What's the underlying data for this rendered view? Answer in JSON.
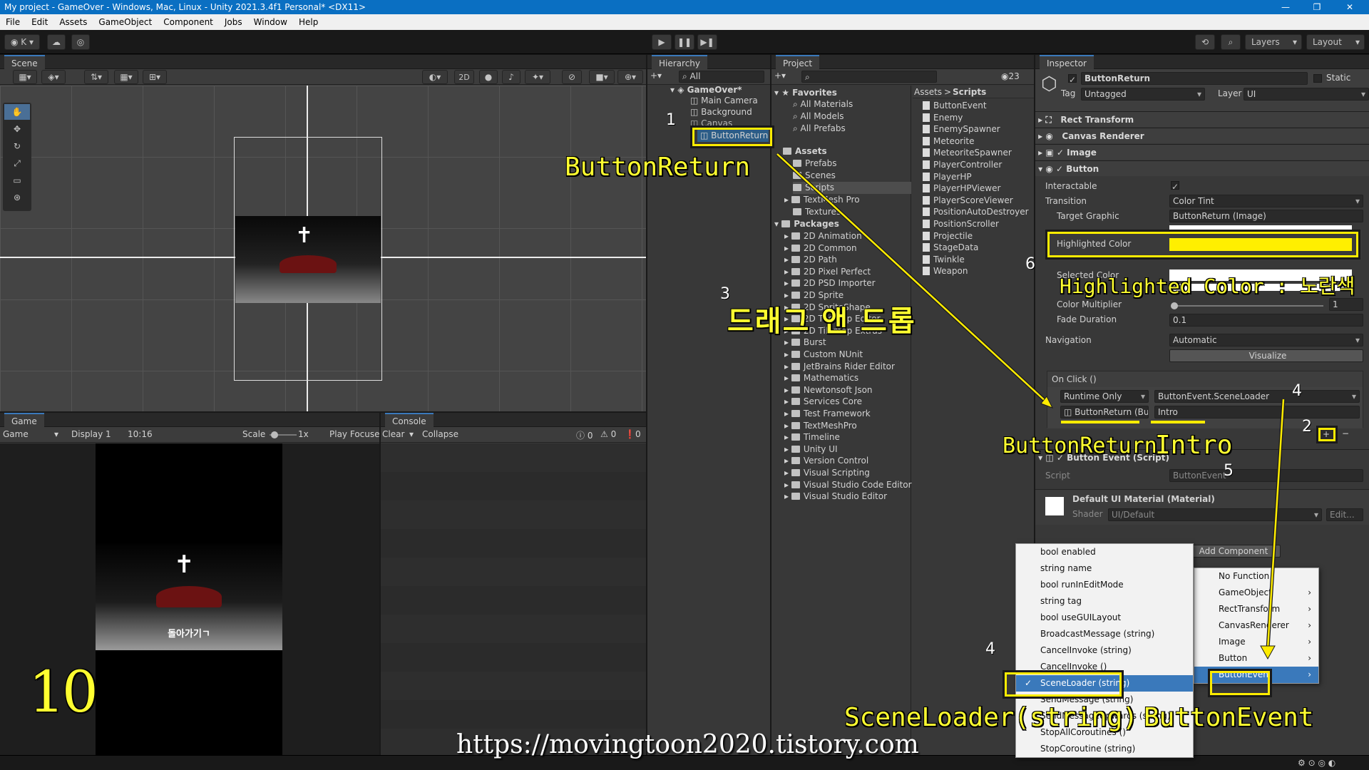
{
  "window": {
    "title": "My project - GameOver - Windows, Mac, Linux - Unity 2021.3.4f1 Personal* <DX11>"
  },
  "menu": [
    "File",
    "Edit",
    "Assets",
    "GameObject",
    "Component",
    "Jobs",
    "Window",
    "Help"
  ],
  "toolbar": {
    "account": "K",
    "layers": "Layers",
    "layout": "Layout"
  },
  "scene": {
    "tab": "Scene",
    "mode2d": "2D"
  },
  "game": {
    "tab": "Game",
    "mode": "Game",
    "display": "Display 1",
    "aspect": "10:16",
    "scale_label": "Scale",
    "scale_value": "1x",
    "play_focus": "Play Focuse",
    "caption": "돌아가기ㄱ"
  },
  "console": {
    "tab": "Console",
    "clear": "Clear",
    "collapse": "Collapse",
    "counts": [
      "0",
      "0",
      "0"
    ]
  },
  "hierarchy": {
    "tab": "Hierarchy",
    "search": "All",
    "root": "GameOver*",
    "items": [
      "Main Camera",
      "Background",
      "Canvas",
      "ButtonReturn"
    ]
  },
  "project": {
    "tab": "Project",
    "count": "23",
    "favorites": "Favorites",
    "fav_items": [
      "All Materials",
      "All Models",
      "All Prefabs"
    ],
    "assets": "Assets",
    "asset_folders": [
      "Prefabs",
      "Scenes",
      "Scripts",
      "TextMesh Pro",
      "Textures"
    ],
    "packages": "Packages",
    "package_folders": [
      "2D Animation",
      "2D Common",
      "2D Path",
      "2D Pixel Perfect",
      "2D PSD Importer",
      "2D Sprite",
      "2D SpriteShape",
      "2D Tilemap Editor",
      "2D Tilemap Extras",
      "Burst",
      "Custom NUnit",
      "JetBrains Rider Editor",
      "Mathematics",
      "Newtonsoft Json",
      "Services Core",
      "Test Framework",
      "TextMeshPro",
      "Timeline",
      "Unity UI",
      "Version Control",
      "Visual Scripting",
      "Visual Studio Code Editor",
      "Visual Studio Editor"
    ],
    "breadcrumb": [
      "Assets",
      "Scripts"
    ],
    "scripts": [
      "ButtonEvent",
      "Enemy",
      "EnemySpawner",
      "Meteorite",
      "MeteoriteSpawner",
      "PlayerController",
      "PlayerHP",
      "PlayerHPViewer",
      "PlayerScoreViewer",
      "PositionAutoDestroyer",
      "PositionScroller",
      "Projectile",
      "StageData",
      "Twinkle",
      "Weapon"
    ]
  },
  "inspector": {
    "tab": "Inspector",
    "name": "ButtonReturn",
    "static": "Static",
    "tag_label": "Tag",
    "tag": "Untagged",
    "layer_label": "Layer",
    "layer": "UI",
    "components": [
      "Rect Transform",
      "Canvas Renderer",
      "Image",
      "Button"
    ],
    "interactable": "Interactable",
    "transition_label": "Transition",
    "transition": "Color Tint",
    "target_graphic_label": "Target Graphic",
    "target_graphic": "ButtonReturn (Image)",
    "highlighted_label": "Highlighted Color",
    "highlighted_color": "#ffef00",
    "selected_label": "Selected Color",
    "color_multiplier_label": "Color Multiplier",
    "color_multiplier": "1",
    "fade_label": "Fade Duration",
    "fade": "0.1",
    "navigation_label": "Navigation",
    "navigation": "Automatic",
    "visualize": "Visualize",
    "onclick": "On Click ()",
    "runtime": "Runtime Only",
    "function": "ButtonEvent.SceneLoader",
    "object": "ButtonReturn (Bu",
    "argument": "Intro",
    "script_comp": "Button Event (Script)",
    "script_label": "Script",
    "script_value": "ButtonEvent",
    "material": "Default UI Material (Material)",
    "shader_label": "Shader",
    "shader": "UI/Default",
    "edit": "Edit...",
    "add_component": "Add Component"
  },
  "func_menu": [
    "No Function",
    "GameObject",
    "RectTransform",
    "CanvasRenderer",
    "Image",
    "Button",
    "ButtonEvent"
  ],
  "method_menu": [
    "bool enabled",
    "string name",
    "bool runInEditMode",
    "string tag",
    "bool useGUILayout",
    "BroadcastMessage (string)",
    "CancelInvoke (string)",
    "CancelInvoke ()",
    "SceneLoader (string)",
    "SendMessage (string)",
    "SendMessageUpwards (string)",
    "StopAllCoroutines ()",
    "StopCoroutine (string)"
  ],
  "annotations": {
    "label_button_return": "ButtonReturn",
    "label_drag": "드래그 앤 드롭",
    "label_highlight": "Highlighted Color : 노란색",
    "label_object": "ButtonReturn",
    "label_intro": "Intro",
    "label_sceneloader": "SceneLoader(string)",
    "label_buttonevent": "ButtonEvent",
    "step_number": "10",
    "url": "https://movingtoon2020.tistory.com",
    "steps": [
      "1",
      "2",
      "3",
      "4",
      "4",
      "5",
      "6"
    ]
  },
  "colors": {
    "annotation": "#ffec00",
    "selection": "#2c5d87",
    "accent": "#3a79bb"
  }
}
